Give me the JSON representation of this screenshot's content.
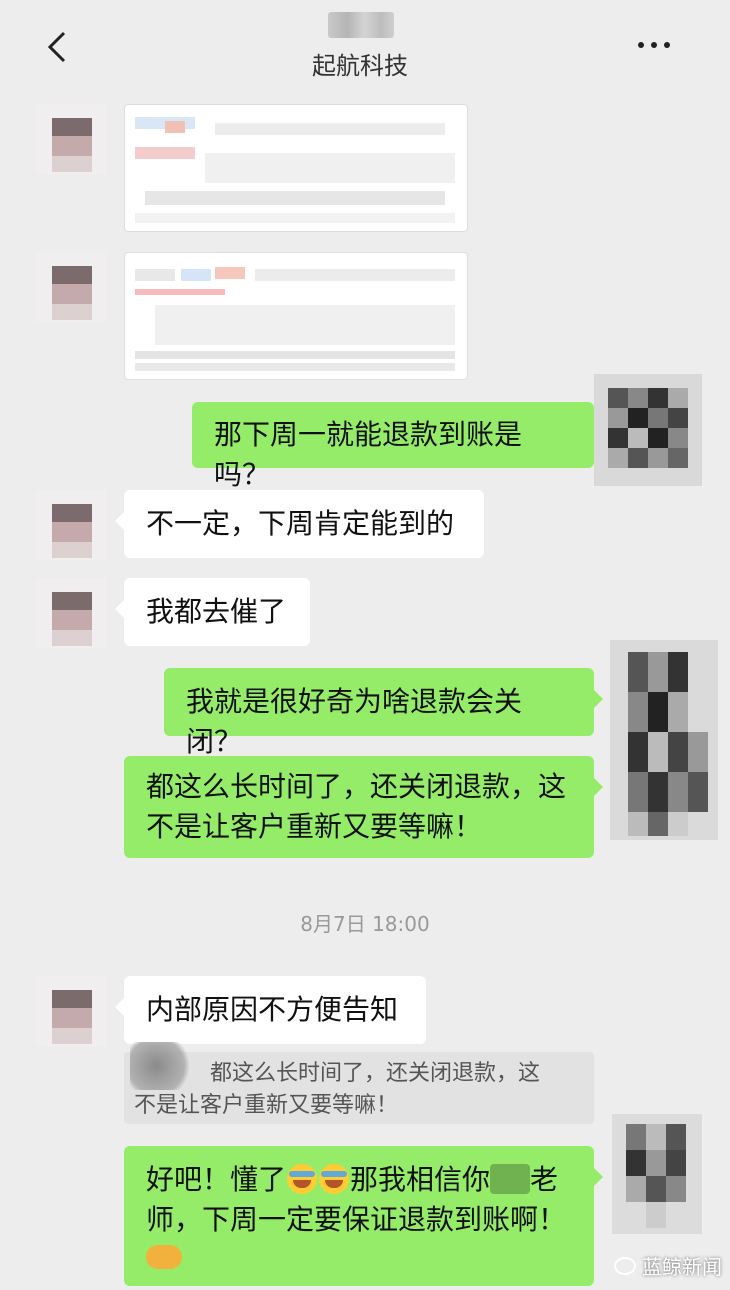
{
  "header": {
    "title": "起航科技",
    "back_icon": "chevron-left-icon",
    "more_icon": "more-dots-icon"
  },
  "messages": [
    {
      "from": "them",
      "type": "image"
    },
    {
      "from": "them",
      "type": "image"
    },
    {
      "from": "me",
      "text": "那下周一就能退款到账是吗？"
    },
    {
      "from": "them",
      "text": "不一定，下周肯定能到的"
    },
    {
      "from": "them",
      "text": "我都去催了"
    },
    {
      "from": "me",
      "text": "我就是很好奇为啥退款会关闭？"
    },
    {
      "from": "me",
      "line1": "都这么长时间了，还关闭退款，这",
      "line2": "不是让客户重新又要等嘛！"
    },
    {
      "from": "them",
      "text": "内部原因不方便告知"
    },
    {
      "from": "me",
      "part1": "好吧！懂了",
      "part2": "那我相信你",
      "part3": "老",
      "line2": "师，下周一定要保证退款到账啊！"
    }
  ],
  "timestamp": "8月7日 18:00",
  "quote": {
    "line1": "都这么长时间了，还关闭退款，这",
    "line2": "不是让客户重新又要等嘛！"
  },
  "watermark": "蓝鲸新闻",
  "colors": {
    "green_bubble": "#95ec69",
    "white_bubble": "#ffffff",
    "background": "#ededed"
  }
}
